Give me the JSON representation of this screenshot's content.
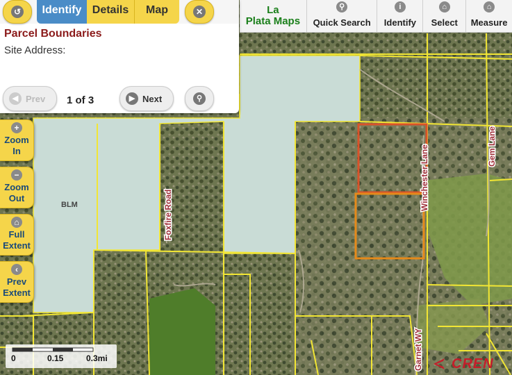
{
  "toolbar": {
    "title_line1": "La",
    "title_line2": "Plata Maps",
    "buttons": [
      {
        "label": "Quick Search",
        "icon": "search-icon"
      },
      {
        "label": "Identify",
        "icon": "info-icon"
      },
      {
        "label": "Select",
        "icon": "home-icon"
      },
      {
        "label": "Measure",
        "icon": "home-icon"
      }
    ]
  },
  "panel": {
    "tabs": {
      "identify": "Identify",
      "details": "Details",
      "map": "Map"
    },
    "title": "Parcel Boundaries",
    "field_label": "Site Address:",
    "prev_label": "Prev",
    "next_label": "Next",
    "counter": "1 of 3"
  },
  "side_buttons": {
    "zoom_in": {
      "line1": "Zoom",
      "line2": "In"
    },
    "zoom_out": {
      "line1": "Zoom",
      "line2": "Out"
    },
    "full_extent": {
      "line1": "Full",
      "line2": "Extent"
    },
    "prev_extent": {
      "line1": "Prev",
      "line2": "Extent"
    }
  },
  "map": {
    "labels": {
      "blm": "BLM",
      "foxfire": "Foxfire Road",
      "winchester": "Winchester Lane",
      "gem": "Gem Lane",
      "garnet": "Garnet WY"
    }
  },
  "scalebar": {
    "l0": "0",
    "l1": "0.15",
    "l2": "0.3mi"
  },
  "logo": {
    "text": "CREN"
  },
  "colors": {
    "accent_yellow": "#f5d54a",
    "tab_blue": "#4a8cc7",
    "parcel_line": "#f2e634",
    "selected_parcel": "#e06a1a",
    "blm_fill": "#c9dcd6",
    "title_red": "#8b1a1a"
  }
}
